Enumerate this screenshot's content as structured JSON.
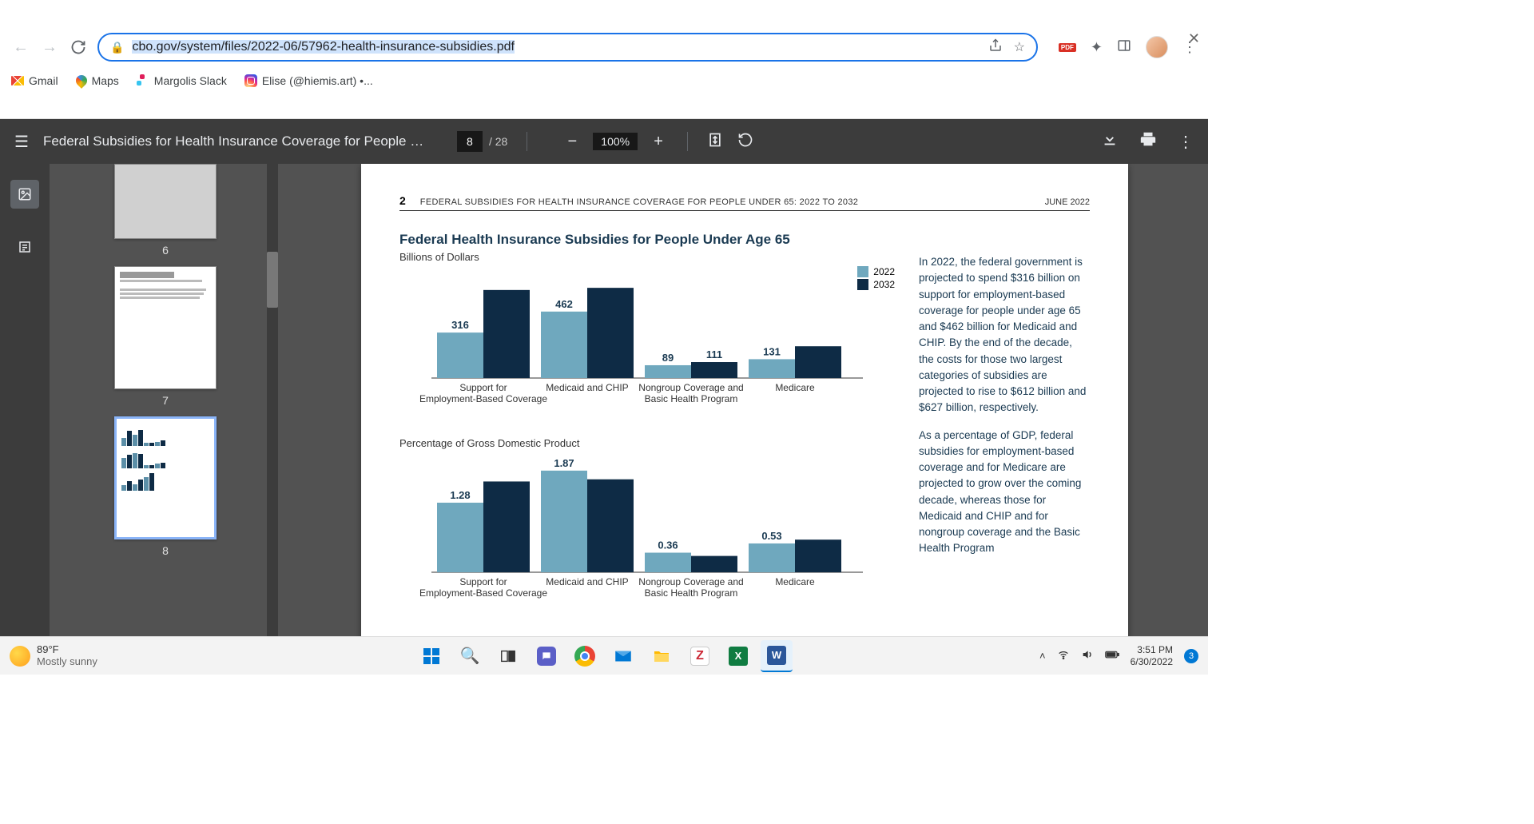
{
  "browser": {
    "url_host": "cbo.gov",
    "url_path": "/system/files/2022-06/57962-health-insurance-subsidies.pdf",
    "bookmarks": {
      "gmail": "Gmail",
      "maps": "Maps",
      "slack": "Margolis Slack",
      "instagram": "Elise (@hiemis.art) •..."
    }
  },
  "pdf": {
    "title": "Federal Subsidies for Health Insurance Coverage for People Un...",
    "page_current": "8",
    "page_total": "/ 28",
    "zoom": "100%",
    "thumbs": {
      "p6": "6",
      "p7": "7",
      "p8": "8"
    }
  },
  "page": {
    "number": "2",
    "running_head": "FEDERAL SUBSIDIES FOR HEALTH INSURANCE COVERAGE FOR PEOPLE UNDER 65: 2022 TO 2032",
    "date": "JUNE 2022",
    "title": "Federal Health Insurance Subsidies for People Under Age 65",
    "subtitle1": "Billions of Dollars",
    "subtitle2": "Percentage of Gross Domestic Product",
    "legend": {
      "y2022": "2022",
      "y2032": "2032"
    },
    "side_text1": "In 2022, the federal government is projected to spend $316 billion on support for employment-based coverage for people under age 65 and $462 billion for Medicaid and CHIP. By the end of the decade, the costs for those two largest categories of subsidies are projected to rise to $612 billion and $627 billion, respectively.",
    "side_text2": "As a percentage of GDP, federal subsidies for employment-based coverage and for Medicare are projected to grow over the coming decade, whereas those for Medicaid and CHIP and for nongroup coverage and the Basic Health Program"
  },
  "chart_data": [
    {
      "type": "bar",
      "title": "Federal Health Insurance Subsidies for People Under Age 65",
      "subtitle": "Billions of Dollars",
      "categories": [
        "Support for Employment-Based Coverage",
        "Medicaid and CHIP",
        "Nongroup Coverage and Basic Health Program",
        "Medicare"
      ],
      "series": [
        {
          "name": "2022",
          "color": "#6fa8be",
          "values": [
            316,
            462,
            89,
            131
          ]
        },
        {
          "name": "2032",
          "color": "#0e2b45",
          "values": [
            612,
            627,
            111,
            221
          ]
        }
      ],
      "ylim": [
        0,
        700
      ]
    },
    {
      "type": "bar",
      "subtitle": "Percentage of Gross Domestic Product",
      "categories": [
        "Support for Employment-Based Coverage",
        "Medicaid and CHIP",
        "Nongroup Coverage and Basic Health Program",
        "Medicare"
      ],
      "series": [
        {
          "name": "2022",
          "color": "#6fa8be",
          "values": [
            1.28,
            1.87,
            0.36,
            0.53
          ]
        },
        {
          "name": "2032",
          "color": "#0e2b45",
          "values": [
            1.67,
            1.71,
            0.3,
            0.6
          ]
        }
      ],
      "ylim": [
        0,
        2.0
      ]
    }
  ],
  "taskbar": {
    "temp": "89°F",
    "cond": "Mostly sunny",
    "time": "3:51 PM",
    "date": "6/30/2022",
    "notif": "3"
  }
}
